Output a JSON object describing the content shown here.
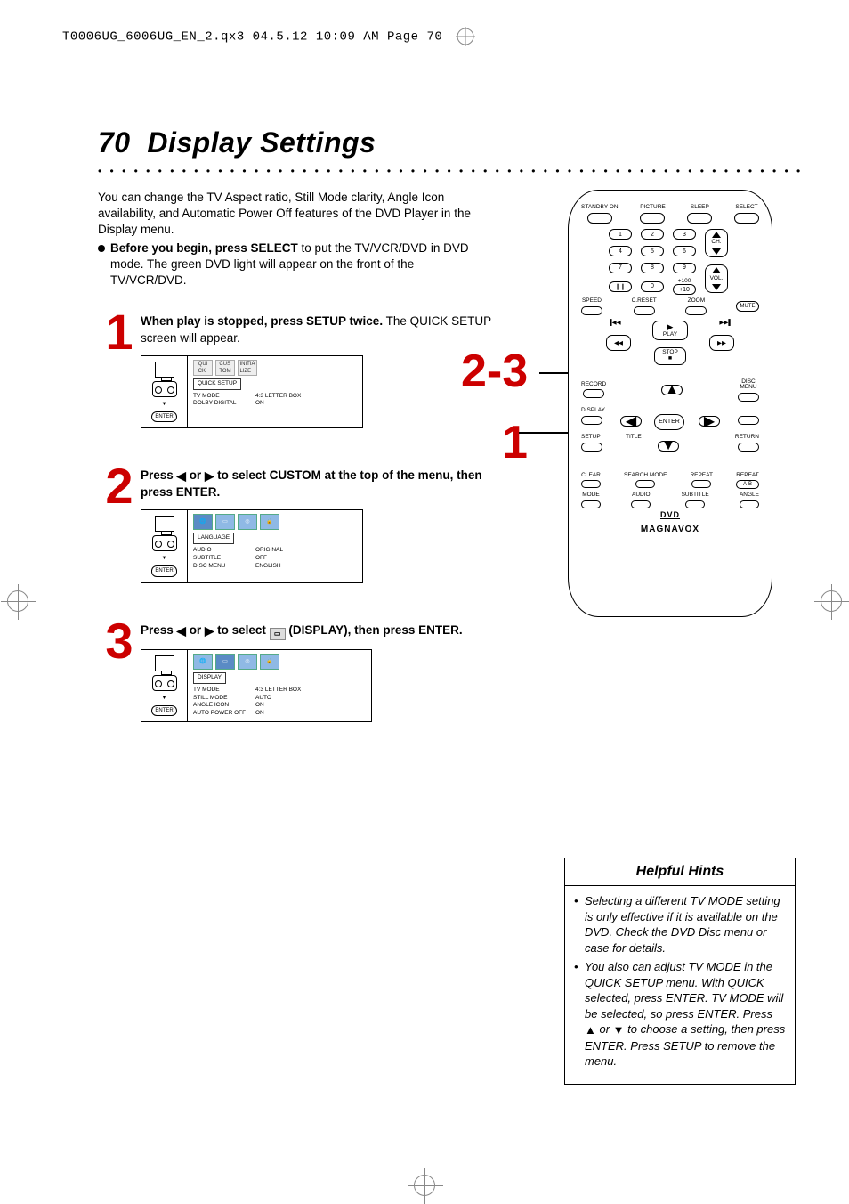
{
  "header_line": "T0006UG_6006UG_EN_2.qx3  04.5.12  10:09 AM  Page 70",
  "page_number": "70",
  "page_title": "Display Settings",
  "intro": {
    "p1": "You can change the TV Aspect ratio, Still Mode clarity,  Angle Icon availability, and Automatic Power Off features of the DVD Player in the Display menu.",
    "bullet_lead": "Before you begin, press SELECT",
    "bullet_rest": " to put the TV/VCR/DVD in DVD mode.  The green DVD light will appear on the front of the TV/VCR/DVD."
  },
  "steps": {
    "s1": {
      "num": "1",
      "bold": "When play is stopped, press SETUP twice.",
      "rest": "  The QUICK SETUP screen will appear.",
      "osd_cat": "QUICK SETUP",
      "osd_rows": [
        {
          "k": "TV MODE",
          "v": "4:3 LETTER BOX"
        },
        {
          "k": "DOLBY DIGITAL",
          "v": "ON"
        }
      ]
    },
    "s2": {
      "num": "2",
      "pre": "Press ",
      "mid": " or ",
      "post": " to select CUSTOM at the top of the menu, then press ENTER.",
      "osd_cat": "LANGUAGE",
      "osd_rows": [
        {
          "k": "AUDIO",
          "v": "ORIGINAL"
        },
        {
          "k": "SUBTITLE",
          "v": "OFF"
        },
        {
          "k": "DISC MENU",
          "v": "ENGLISH"
        }
      ]
    },
    "s3": {
      "num": "3",
      "pre": "Press ",
      "mid": " or ",
      "post_a": " to select  ",
      "post_b": "  (DISPLAY), then press ENTER.",
      "osd_cat": "DISPLAY",
      "osd_rows": [
        {
          "k": "TV MODE",
          "v": "4:3 LETTER BOX"
        },
        {
          "k": "STILL MODE",
          "v": "AUTO"
        },
        {
          "k": "ANGLE ICON",
          "v": "ON"
        },
        {
          "k": "AUTO POWER OFF",
          "v": "ON"
        }
      ]
    }
  },
  "callouts": {
    "c1": "2-3",
    "c2": "1"
  },
  "remote": {
    "top_row": [
      "STANDBY-ON",
      "PICTURE",
      "SLEEP",
      "SELECT"
    ],
    "nums": [
      "1",
      "2",
      "3",
      "4",
      "5",
      "6",
      "7",
      "8",
      "9"
    ],
    "plus100": "+100",
    "ch": "CH.",
    "vol": "VOL.",
    "pause_sym": "❙❙",
    "zero": "0",
    "plus10": "+10",
    "row_sczm": [
      "SPEED",
      "C.RESET",
      "ZOOM"
    ],
    "mute": "MUTE",
    "play": "PLAY",
    "stop": "STOP",
    "record": "RECORD",
    "disc_menu": "DISC\nMENU",
    "display": "DISPLAY",
    "enter": "ENTER",
    "setup": "SETUP",
    "title": "TITLE",
    "return": "RETURN",
    "row_clear": [
      "CLEAR",
      "SEARCH MODE",
      "REPEAT",
      "REPEAT"
    ],
    "ab": "A-B",
    "row_mode": [
      "MODE",
      "AUDIO",
      "SUBTITLE",
      "ANGLE"
    ],
    "dvd_logo": "DVD",
    "brand": "MAGNAVOX"
  },
  "hints": {
    "title": "Helpful Hints",
    "items": [
      "Selecting a different TV MODE setting is only effective if it is available on the DVD. Check the DVD Disc menu or case for details.",
      {
        "pre": "You also can adjust TV MODE in the QUICK SETUP menu. With QUICK selected, press ENTER. TV MODE will be selected, so press ENTER. Press ",
        "mid": " or ",
        "post": " to choose a setting, then press ENTER. Press SETUP to remove the menu."
      }
    ]
  },
  "osd_enter": "ENTER"
}
